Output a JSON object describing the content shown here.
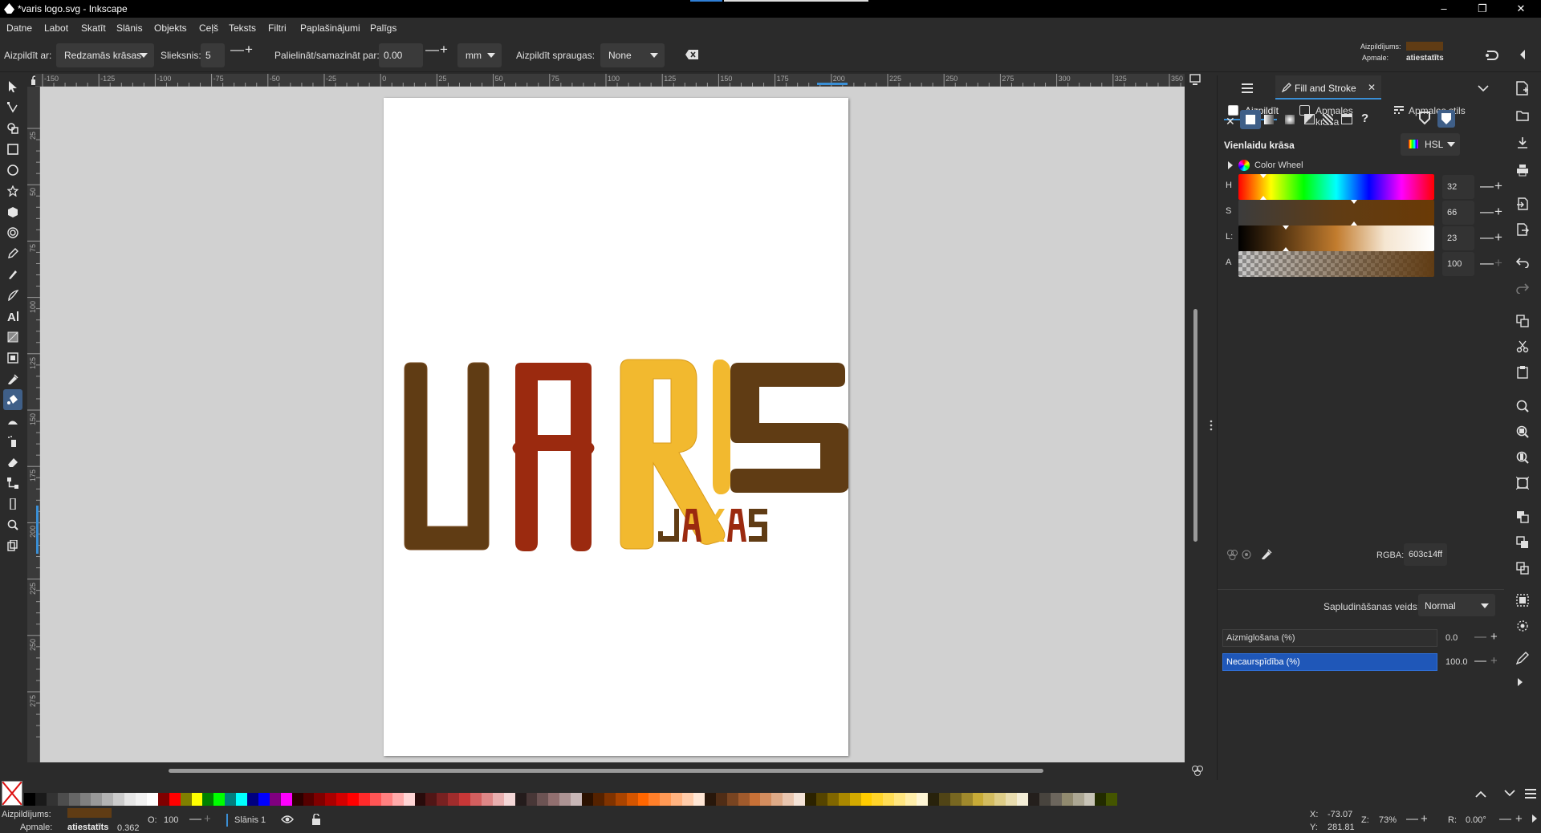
{
  "window": {
    "title": "*varis logo.svg - Inkscape"
  },
  "menu": [
    "Datne",
    "Labot",
    "Skatīt",
    "Slānis",
    "Objekts",
    "Ceļš",
    "Teksts",
    "Filtri",
    "Paplašinājumi",
    "Palīgs"
  ],
  "toolbar": {
    "fill_by_label": "Aizpildīt ar:",
    "fill_by_value": "Redzamās krāsas",
    "threshold_label": "Slieksnis:",
    "threshold_value": "5",
    "grow_label": "Palielināt/samazināt par:",
    "grow_value": "0.00",
    "unit_value": "mm",
    "close_gaps_label": "Aizpildīt spraugas:",
    "close_gaps_value": "None",
    "style_fill_label": "Aizpildījums:",
    "style_stroke_label": "Apmale:",
    "style_stroke_value": "atiestatīts",
    "fill_color": "#603c14"
  },
  "ruler": {
    "h_labels": [
      "-150",
      "-125",
      "-100",
      "-75",
      "-50",
      "-25",
      "0",
      "25",
      "50",
      "75",
      "100",
      "125",
      "150",
      "175",
      "200",
      "225",
      "250",
      "275",
      "300",
      "325",
      "350"
    ],
    "v_labels": [
      "25",
      "50",
      "75",
      "100",
      "125",
      "150",
      "175",
      "200",
      "225",
      "250",
      "275"
    ]
  },
  "logo": {
    "letters": [
      "U",
      "A",
      "R",
      "I",
      "S"
    ],
    "sub": [
      "J",
      "A",
      "K",
      "A",
      "S"
    ],
    "colors": {
      "brown": "#603c14",
      "red": "#9b2a0f",
      "yellow": "#f2b92f"
    }
  },
  "panel": {
    "dialog_tab": "Fill and Stroke",
    "tabs": [
      "Aizpildīt",
      "Apmales krāsa",
      "Apmales stils"
    ],
    "paint_heading": "Vienlaidu krāsa",
    "color_mode": "HSL",
    "color_wheel_label": "Color Wheel",
    "sliders": [
      {
        "label": "H",
        "value": "32"
      },
      {
        "label": "S",
        "value": "66"
      },
      {
        "label": "L:",
        "value": "23"
      },
      {
        "label": "A",
        "value": "100"
      }
    ],
    "rgba_label": "RGBA:",
    "rgba_value": "603c14ff",
    "blend_label": "Sapludināšanas veids:",
    "blend_value": "Normal",
    "blur_label": "Aizmiglošana (%)",
    "blur_value": "0.0",
    "opacity_label": "Necaurspīdība (%)",
    "opacity_value": "100.0"
  },
  "status": {
    "fill_label": "Aizpildījums:",
    "stroke_label": "Apmale:",
    "stroke_value": "atiestatīts",
    "stroke_width": "0.362",
    "opacity_label": "O:",
    "opacity_value": "100",
    "layer_name": "Slānis 1",
    "x_label": "X:",
    "x_value": "-73.07",
    "y_label": "Y:",
    "y_value": "281.81",
    "zoom_label": "Z:",
    "zoom_value": "73%",
    "rotation_label": "R:",
    "rotation_value": "0.00°"
  }
}
